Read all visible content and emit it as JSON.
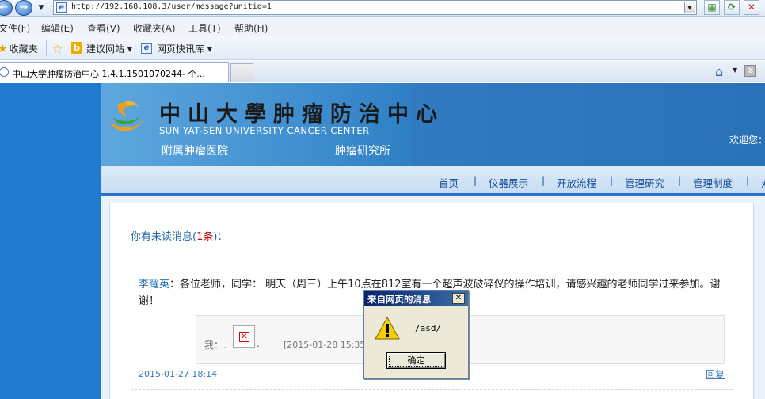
{
  "browser": {
    "address": "http://192.168.108.3/user/message?unitid=1",
    "menu": [
      "文件(F)",
      "编辑(E)",
      "查看(V)",
      "收藏夹(A)",
      "工具(T)",
      "帮助(H)"
    ],
    "favorites_label": "收藏夹",
    "suggested_sites": "建议网站 ▾",
    "web_slice": "网页快讯库 ▾",
    "tab_title": "中山大学肿瘤防治中心 1.4.1.1501070244- 个..."
  },
  "site": {
    "logo_cn": "中山大學肿瘤防治中心",
    "logo_en": "SUN YAT-SEN UNIVERSITY CANCER CENTER",
    "hospital": "附属肿瘤医院",
    "institute": "肿瘤研究所",
    "welcome": "欢迎您："
  },
  "nav": {
    "items": [
      "首页",
      "仪器展示",
      "开放流程",
      "管理研究",
      "管理制度",
      "对"
    ],
    "separator": "|"
  },
  "messages": {
    "unread_prefix": "你有未读消息(",
    "unread_count": "1条",
    "unread_suffix": ")：",
    "item": {
      "author": "李耀英",
      "colon": "：",
      "text": "各位老师，同学： 明天（周三）上午10点在812室有一个超声波破碎仪的操作培训，请感兴趣的老师同学过来参加。谢谢！",
      "reply_prefix": "我：.",
      "reply_suffix": ".",
      "reply_date": "[2015-01-28 15:35",
      "date": "2015-01-27 18:14",
      "reply_link": "回复"
    }
  },
  "dialog": {
    "title": "来自网页的消息",
    "close": "✕",
    "message": "/asd/",
    "ok": "确定"
  }
}
